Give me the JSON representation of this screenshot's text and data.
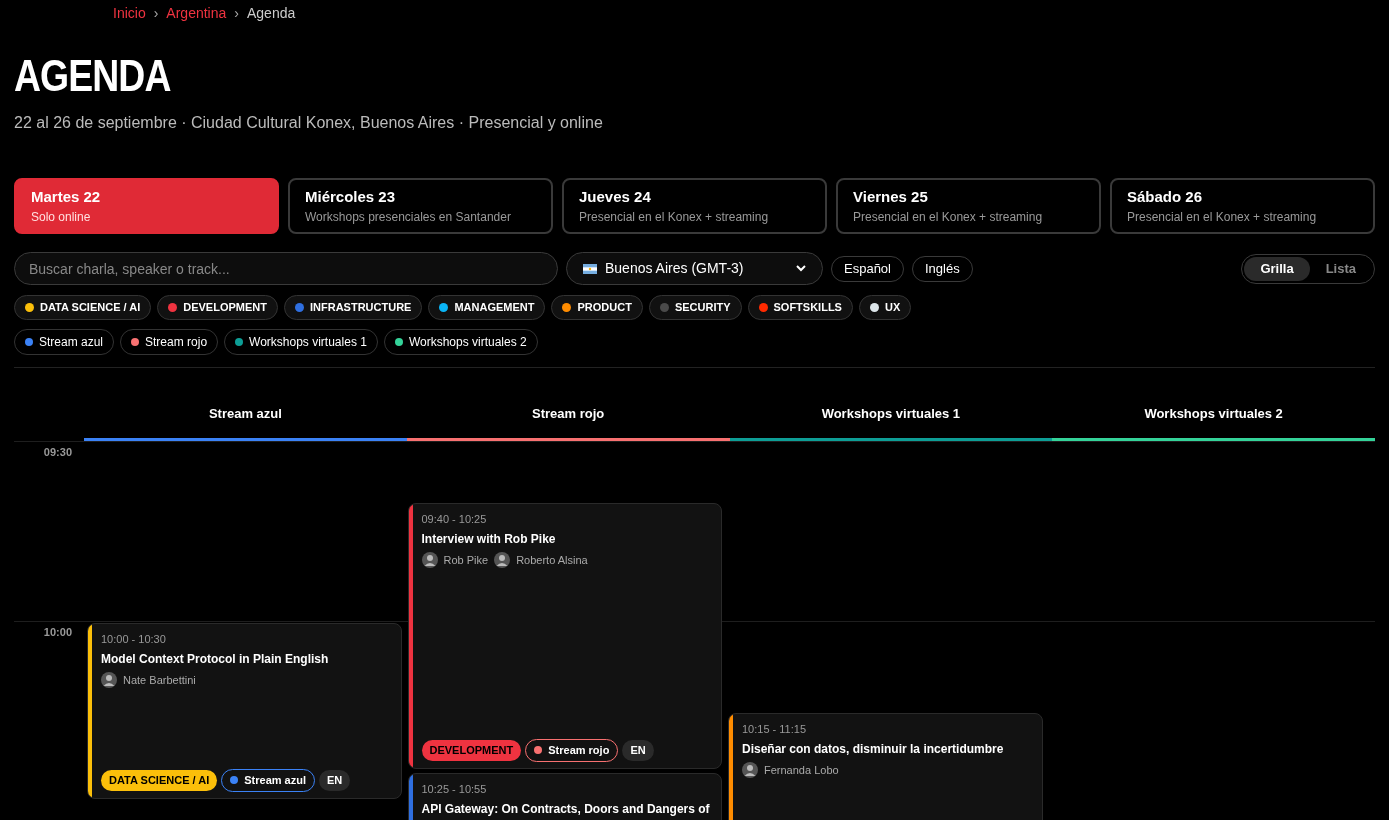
{
  "breadcrumb": [
    {
      "label": "Inicio",
      "link": true
    },
    {
      "label": "Argentina",
      "link": true
    },
    {
      "label": "Agenda",
      "link": false
    }
  ],
  "breadcrumb_separator": "›",
  "title": "AGENDA",
  "subtitle": "22 al 26 de septiembre · Ciudad Cultural Konex, Buenos Aires · Presencial y online",
  "days": [
    {
      "label": "Martes 22",
      "note": "Solo online",
      "selected": true
    },
    {
      "label": "Miércoles 23",
      "note": "Workshops presenciales en Santander",
      "selected": false
    },
    {
      "label": "Jueves 24",
      "note": "Presencial en el Konex + streaming",
      "selected": false
    },
    {
      "label": "Viernes 25",
      "note": "Presencial en el Konex + streaming",
      "selected": false
    },
    {
      "label": "Sábado 26",
      "note": "Presencial en el Konex + streaming",
      "selected": false
    }
  ],
  "search": {
    "placeholder": "Buscar charla, speaker o track..."
  },
  "timezone": {
    "value": "Buenos Aires (GMT-3)"
  },
  "languages": [
    "Español",
    "Inglés"
  ],
  "view_toggle": [
    {
      "label": "Grilla",
      "selected": true
    },
    {
      "label": "Lista",
      "selected": false
    }
  ],
  "track_filters": [
    {
      "label": "DATA SCIENCE / AI",
      "color": "#fbbf0a"
    },
    {
      "label": "DEVELOPMENT",
      "color": "#ef3340"
    },
    {
      "label": "INFRASTRUCTURE",
      "color": "#2f6fe0"
    },
    {
      "label": "MANAGEMENT",
      "color": "#0ab4f5"
    },
    {
      "label": "PRODUCT",
      "color": "#ff8c00"
    },
    {
      "label": "SECURITY",
      "color": "#4a4a4a"
    },
    {
      "label": "SOFTSKILLS",
      "color": "#ff2a00"
    },
    {
      "label": "UX",
      "color": "#dde6ea"
    }
  ],
  "stream_filters": [
    {
      "label": "Stream azul",
      "color": "#3b82f6"
    },
    {
      "label": "Stream rojo",
      "color": "#f87171"
    },
    {
      "label": "Workshops virtuales 1",
      "color": "#0d9e96"
    },
    {
      "label": "Workshops virtuales 2",
      "color": "#34d399"
    }
  ],
  "columns": [
    {
      "label": "Stream azul",
      "color": "#3b82f6"
    },
    {
      "label": "Stream rojo",
      "color": "#f87171"
    },
    {
      "label": "Workshops virtuales 1",
      "color": "#0d9e96"
    },
    {
      "label": "Workshops virtuales 2",
      "color": "#34d399"
    }
  ],
  "time_labels": [
    "09:30",
    "10:00"
  ],
  "sessions": [
    {
      "time": "09:40 - 10:25",
      "title": "Interview with Rob Pike",
      "color": "#ef3340",
      "speakers": [
        "Rob Pike",
        "Roberto Alsina"
      ],
      "tags": [
        {
          "kind": "track",
          "label": "DEVELOPMENT",
          "color": "#ef3340"
        },
        {
          "kind": "stream",
          "label": "Stream rojo",
          "color": "#f87171"
        },
        {
          "kind": "lang",
          "label": "EN"
        }
      ]
    },
    {
      "time": "10:00 - 10:30",
      "title": "Model Context Protocol in Plain English",
      "color": "#fbbf0a",
      "speakers": [
        "Nate Barbettini"
      ],
      "tags": [
        {
          "kind": "track",
          "label": "DATA SCIENCE / AI",
          "color": "#fbbf0a"
        },
        {
          "kind": "stream",
          "label": "Stream azul",
          "color": "#3b82f6"
        },
        {
          "kind": "lang",
          "label": "EN"
        }
      ]
    },
    {
      "time": "10:15 - 11:15",
      "title": "Diseñar con datos, disminuir la incertidumbre",
      "color": "#ff8c00",
      "speakers": [
        "Fernanda Lobo"
      ]
    },
    {
      "time": "10:25 - 10:55",
      "title": "API Gateway: On Contracts, Doors and Dangers of",
      "color": "#2f6fe0"
    }
  ]
}
